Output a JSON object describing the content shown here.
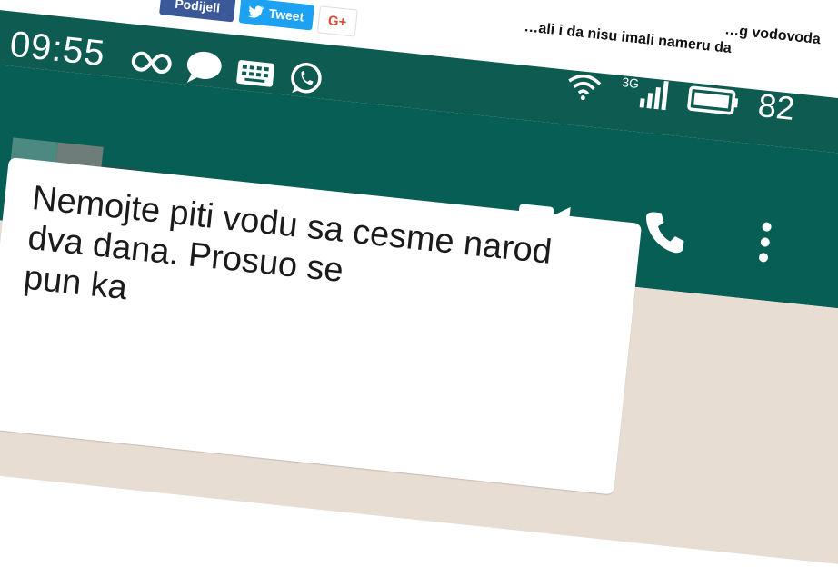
{
  "share": {
    "facebook_label": "Podijeli",
    "tweet_label": "Tweet",
    "gplus_label": "G+"
  },
  "article_text": {
    "line1": "…g vodovoda",
    "line2": "…ali i da nisu imali nameru da"
  },
  "status_bar": {
    "time": "09:55",
    "network_label": "3G",
    "battery_percent": "82"
  },
  "icons": [
    "infinity-icon",
    "chat-bubble-icon",
    "keyboard-icon",
    "whatsapp-icon",
    "wifi-icon",
    "signal-icon",
    "battery-icon",
    "video-call-icon",
    "phone-icon",
    "more-vertical-icon"
  ],
  "message": {
    "line1": "Nemojte piti vodu sa cesme narod",
    "line2": "dva dana. Prosuo se",
    "line3": "pun ka"
  },
  "colors": {
    "header": "#075e54",
    "statusbar": "#0e5b52",
    "chat_bg": "#e8ddd3"
  }
}
